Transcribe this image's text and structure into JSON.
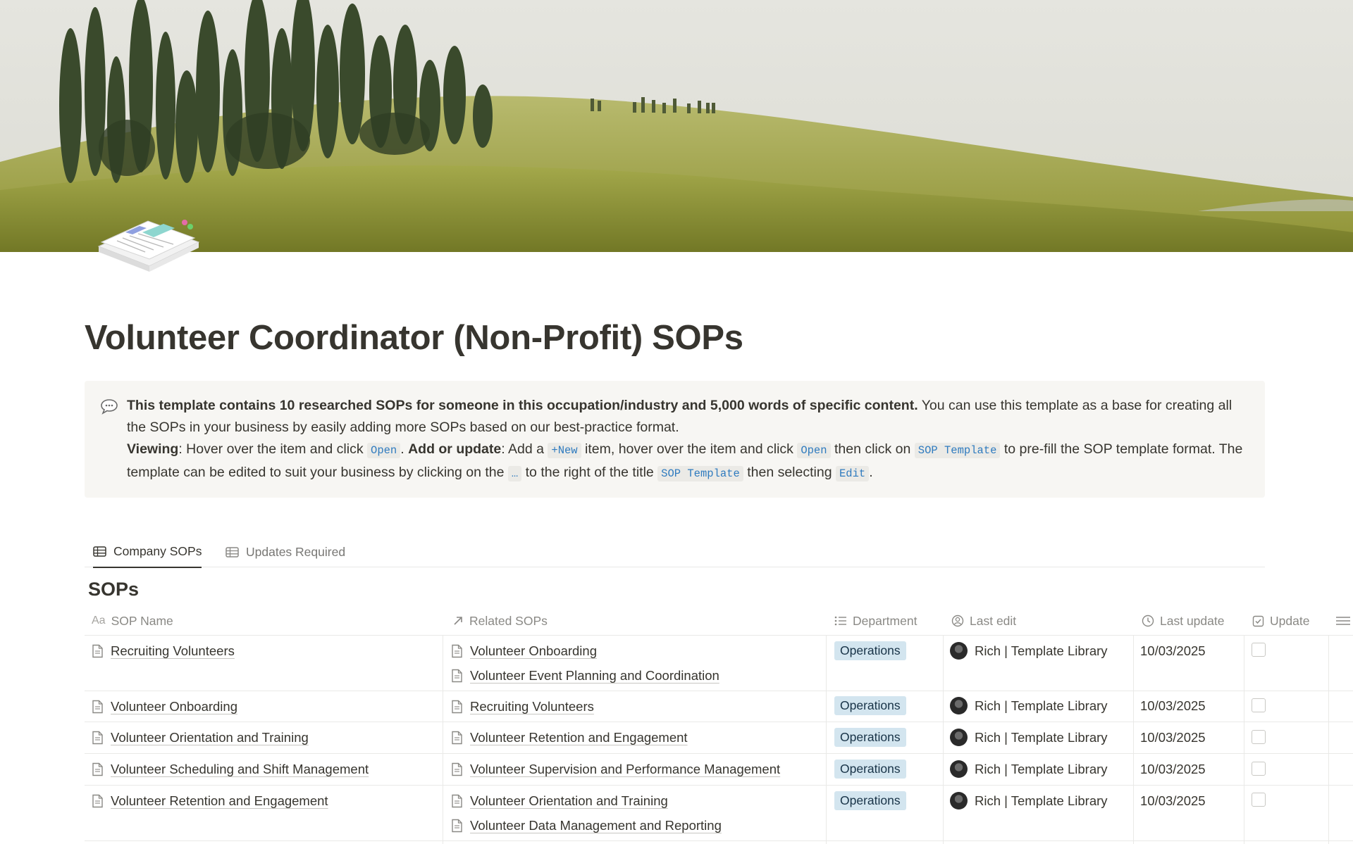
{
  "page": {
    "title": "Volunteer Coordinator (Non-Profit) SOPs",
    "cover": "rolling-hills-cypress-trees",
    "icon": "document-stack-icon"
  },
  "callout": {
    "icon": "speech-bubble-icon",
    "line1_bold": "This template contains 10 researched SOPs for someone in this occupation/industry and 5,000 words of specific content.",
    "line1_rest": " You can use this template as a base for creating all the SOPs in your business by easily adding more SOPs based on our best-practice format.",
    "viewing_label": "Viewing",
    "viewing_text": ": Hover over the item and click ",
    "code_open": "Open",
    "after_open": ". ",
    "add_label": "Add or update",
    "add_text1": ": Add a ",
    "code_new": "+New",
    "add_text2": " item, hover over the item and click ",
    "code_open2": "Open",
    "add_text3": " then click on ",
    "code_sop_template": "SOP Template",
    "add_text4": " to pre-fill the SOP template format. The template can be edited to suit your business by clicking on the ",
    "code_dots": "…",
    "add_text5": " to the right of the title ",
    "code_sop_template2": "SOP Template",
    "add_text6": " then selecting ",
    "code_edit": "Edit",
    "add_text7": "."
  },
  "tabs": [
    {
      "label": "Company SOPs",
      "active": true
    },
    {
      "label": "Updates Required",
      "active": false
    }
  ],
  "section_title": "SOPs",
  "columns": {
    "name": "SOP Name",
    "related": "Related SOPs",
    "department": "Department",
    "last_edit": "Last edit",
    "last_update": "Last update",
    "update": "Update",
    "name_prefix": "Aa"
  },
  "rows": [
    {
      "name": "Recruiting Volunteers",
      "related": [
        "Volunteer Onboarding",
        "Volunteer Event Planning and Coordination"
      ],
      "department": "Operations",
      "editor": "Rich | Template Library",
      "date": "10/03/2025",
      "update": false
    },
    {
      "name": "Volunteer Onboarding",
      "related": [
        "Recruiting Volunteers"
      ],
      "department": "Operations",
      "editor": "Rich | Template Library",
      "date": "10/03/2025",
      "update": false
    },
    {
      "name": "Volunteer Orientation and Training",
      "related": [
        "Volunteer Retention and Engagement"
      ],
      "department": "Operations",
      "editor": "Rich | Template Library",
      "date": "10/03/2025",
      "update": false
    },
    {
      "name": "Volunteer Scheduling and Shift Management",
      "related": [
        "Volunteer Supervision and Performance Management"
      ],
      "department": "Operations",
      "editor": "Rich | Template Library",
      "date": "10/03/2025",
      "update": false
    },
    {
      "name": "Volunteer Retention and Engagement",
      "related": [
        "Volunteer Orientation and Training",
        "Volunteer Data Management and Reporting"
      ],
      "department": "Operations",
      "editor": "Rich | Template Library",
      "date": "10/03/2025",
      "update": false
    }
  ],
  "colors": {
    "tag_bg": "#d3e5ef",
    "tag_text": "#183347",
    "code_text": "#2f7bbf",
    "callout_bg": "#f7f6f3"
  }
}
